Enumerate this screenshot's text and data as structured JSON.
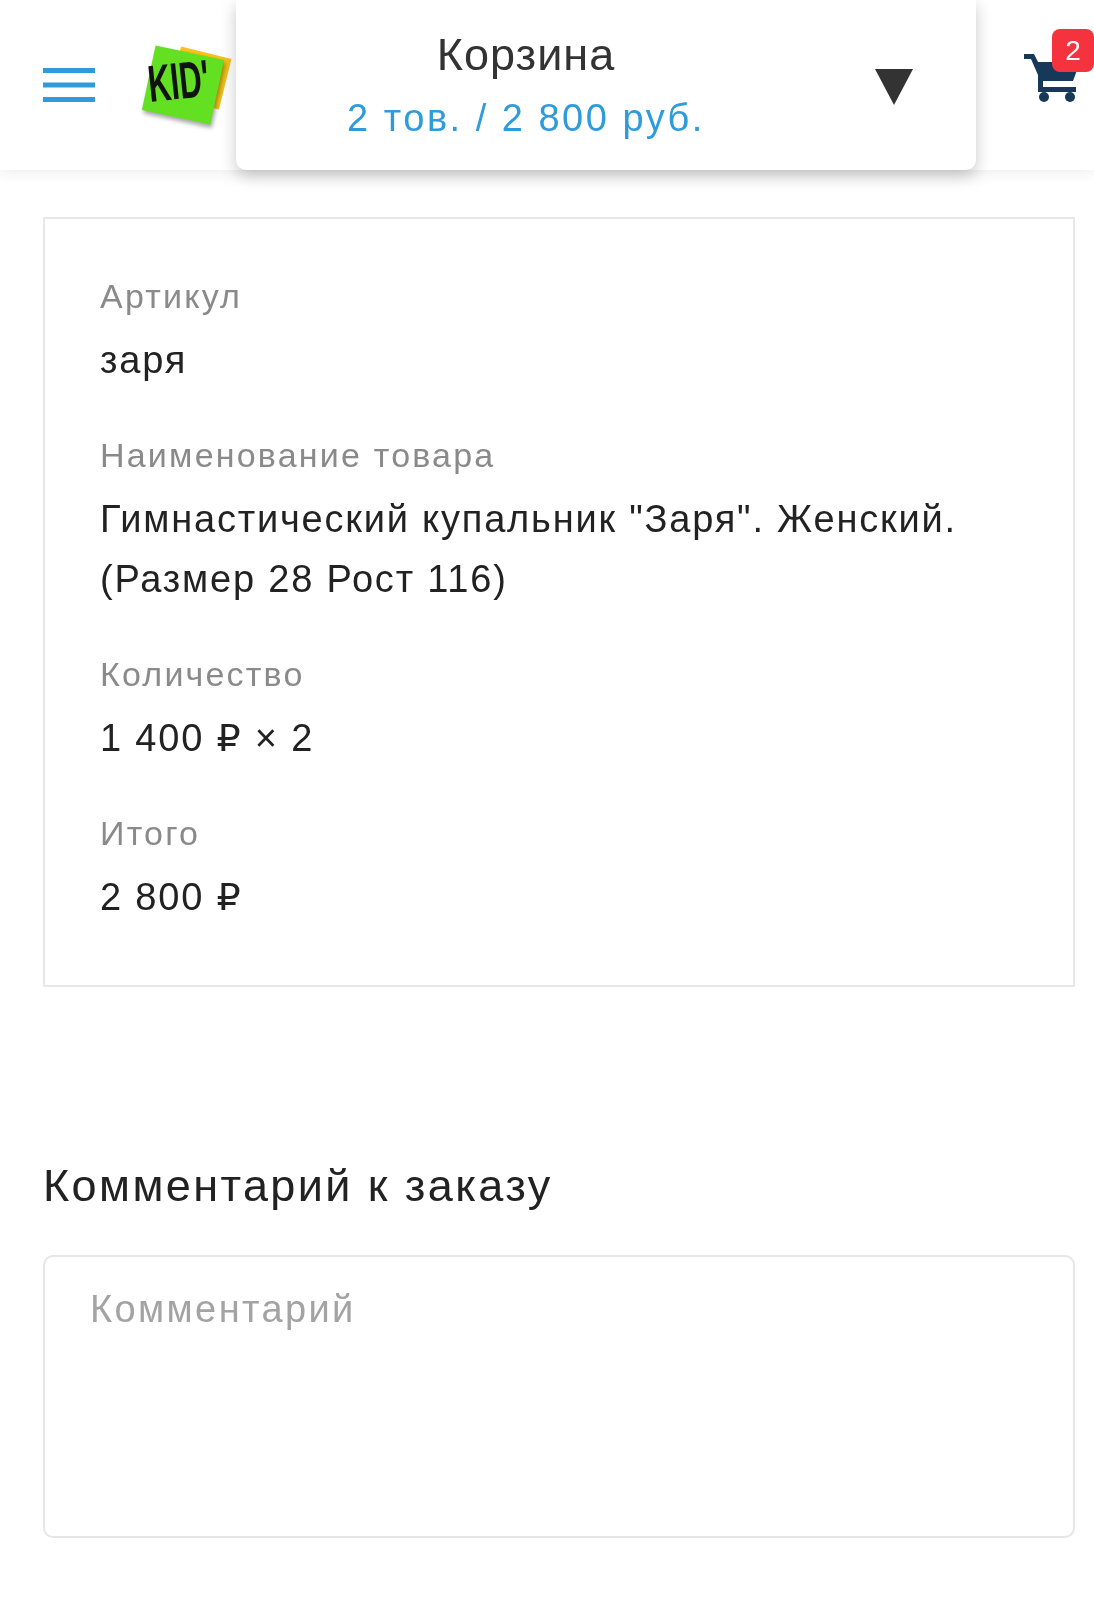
{
  "header": {
    "logo": {
      "text": "KID'"
    },
    "cart_dropdown": {
      "title": "Корзина",
      "summary": "2 тов. / 2 800 руб."
    },
    "cart_badge": "2"
  },
  "order_item": {
    "fields": [
      {
        "label": "Артикул",
        "value": "заря"
      },
      {
        "label": "Наименование товара",
        "value": "Гимнастический купальник \"Заря\". Женский. (Размер 28 Рост 116)"
      },
      {
        "label": "Количество",
        "value": "1 400 ₽ × 2"
      },
      {
        "label": "Итого",
        "value": "2 800 ₽"
      }
    ]
  },
  "comment": {
    "heading": "Комментарий к заказу",
    "placeholder": "Комментарий"
  }
}
